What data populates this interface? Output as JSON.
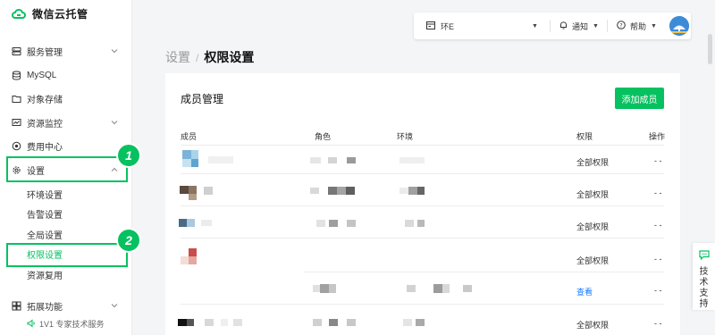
{
  "app": {
    "title": "微信云托管"
  },
  "sidebar": {
    "items": [
      {
        "label": "服务管理",
        "icon": "server-icon",
        "has_chevron": true
      },
      {
        "label": "MySQL",
        "icon": "database-icon",
        "has_chevron": false
      },
      {
        "label": "对象存储",
        "icon": "folder-icon",
        "has_chevron": false
      },
      {
        "label": "资源监控",
        "icon": "monitor-icon",
        "has_chevron": true
      },
      {
        "label": "费用中心",
        "icon": "coin-icon",
        "has_chevron": false
      },
      {
        "label": "设置",
        "icon": "gear-icon",
        "has_chevron": true,
        "expanded": true
      },
      {
        "label": "拓展功能",
        "icon": "extension-icon",
        "has_chevron": true
      }
    ],
    "settings_children": [
      "环境设置",
      "告警设置",
      "全局设置",
      "权限设置",
      "资源复用"
    ],
    "active_child": "权限设置",
    "footer": "1V1 专家技术服务",
    "annotations": [
      "1",
      "2"
    ]
  },
  "topbar": {
    "env_label": "环E",
    "notify_label": "通知",
    "help_label": "帮助"
  },
  "breadcrumb": {
    "parent": "设置",
    "separator": "/",
    "current": "权限设置"
  },
  "members": {
    "title": "成员管理",
    "add_button": "添加成员",
    "columns": [
      "成员",
      "角色",
      "环境",
      "权限",
      "操作"
    ],
    "rows": [
      {
        "permission": "全部权限",
        "action": "- -"
      },
      {
        "permission": "全部权限",
        "action": "- -"
      },
      {
        "permission": "全部权限",
        "action": "- -"
      },
      {
        "permission": "全部权限",
        "action": "- -"
      },
      {
        "permission": "查看",
        "action": "- -"
      },
      {
        "permission": "全部权限",
        "action": "- -"
      }
    ]
  },
  "support": {
    "label": "技术支持"
  },
  "colors": {
    "accent": "#07c160",
    "link": "#1677ff"
  }
}
